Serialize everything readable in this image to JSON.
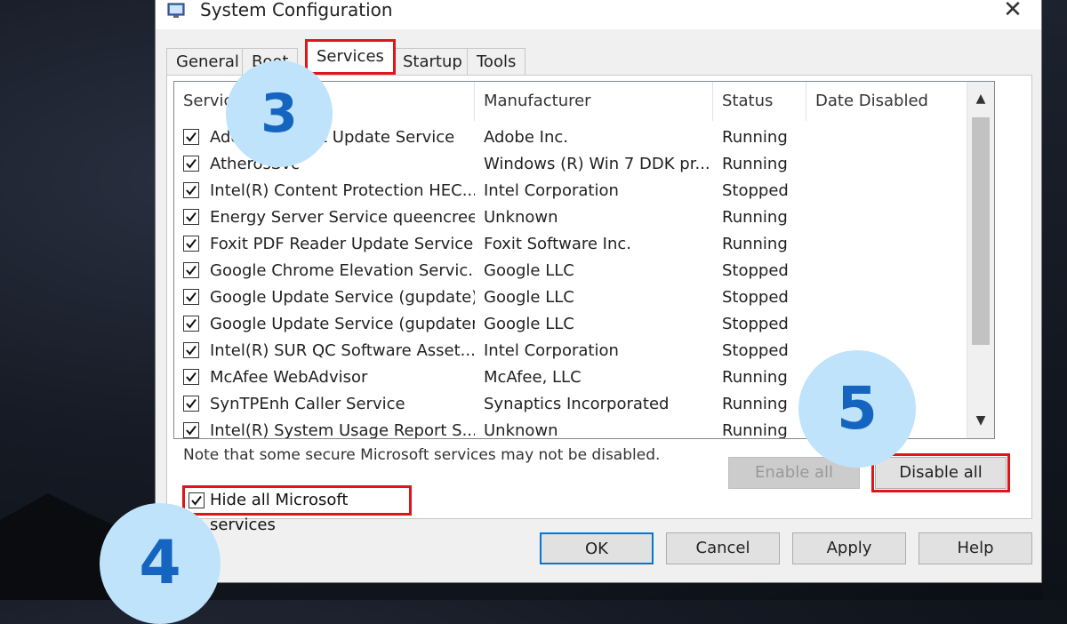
{
  "window": {
    "title": "System Configuration",
    "close_label": "✕"
  },
  "tabs": [
    "General",
    "Boot",
    "Services",
    "Startup",
    "Tools"
  ],
  "active_tab": "Services",
  "columns": {
    "service": "Service",
    "manufacturer": "Manufacturer",
    "status": "Status",
    "date_disabled": "Date Disabled"
  },
  "services": [
    {
      "checked": true,
      "name": "Adobe Acrobat Update Service",
      "manufacturer": "Adobe Inc.",
      "status": "Running",
      "date_disabled": ""
    },
    {
      "checked": true,
      "name": "AtherosSvc",
      "manufacturer": "Windows (R) Win 7 DDK pr...",
      "status": "Running",
      "date_disabled": ""
    },
    {
      "checked": true,
      "name": "Intel(R) Content Protection HEC...",
      "manufacturer": "Intel Corporation",
      "status": "Stopped",
      "date_disabled": ""
    },
    {
      "checked": true,
      "name": "Energy Server Service queencreek",
      "manufacturer": "Unknown",
      "status": "Running",
      "date_disabled": ""
    },
    {
      "checked": true,
      "name": "Foxit PDF Reader Update Service",
      "manufacturer": "Foxit Software Inc.",
      "status": "Running",
      "date_disabled": ""
    },
    {
      "checked": true,
      "name": "Google Chrome Elevation Servic...",
      "manufacturer": "Google LLC",
      "status": "Stopped",
      "date_disabled": ""
    },
    {
      "checked": true,
      "name": "Google Update Service (gupdate)",
      "manufacturer": "Google LLC",
      "status": "Stopped",
      "date_disabled": ""
    },
    {
      "checked": true,
      "name": "Google Update Service (gupdatem)",
      "manufacturer": "Google LLC",
      "status": "Stopped",
      "date_disabled": ""
    },
    {
      "checked": true,
      "name": "Intel(R) SUR QC Software Asset...",
      "manufacturer": "Intel Corporation",
      "status": "Stopped",
      "date_disabled": ""
    },
    {
      "checked": true,
      "name": "McAfee WebAdvisor",
      "manufacturer": "McAfee, LLC",
      "status": "Running",
      "date_disabled": ""
    },
    {
      "checked": true,
      "name": "SynTPEnh Caller Service",
      "manufacturer": "Synaptics Incorporated",
      "status": "Running",
      "date_disabled": ""
    },
    {
      "checked": true,
      "name": "Intel(R) System Usage Report S...",
      "manufacturer": "Unknown",
      "status": "Running",
      "date_disabled": ""
    }
  ],
  "note": "Note that some secure Microsoft services may not be disabled.",
  "hide_ms": {
    "label": "Hide all Microsoft services",
    "checked": true
  },
  "buttons": {
    "enable_all": "Enable all",
    "disable_all": "Disable all",
    "ok": "OK",
    "cancel": "Cancel",
    "apply": "Apply",
    "help": "Help"
  },
  "steps": {
    "tab": "3",
    "checkbox": "4",
    "button": "5"
  },
  "colors": {
    "highlight": "#e0141b",
    "badge_bg": "#bfe3fb",
    "badge_text": "#1565c0",
    "focus": "#0078d7"
  }
}
